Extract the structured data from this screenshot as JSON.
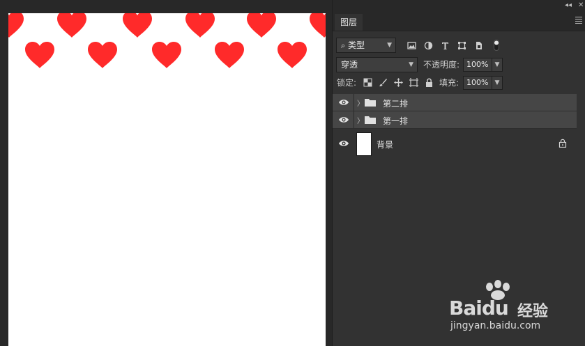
{
  "canvas": {
    "background": "#ffffff",
    "heart_color": "#ff2a2a"
  },
  "panel": {
    "collapse_icon": "double-chevron-left-icon",
    "close_icon": "close-icon",
    "tab_label": "图层",
    "menu_icon": "hamburger-menu-icon"
  },
  "filter": {
    "search_icon": "search-icon",
    "kind_label": "类型",
    "icons": [
      "image-filter-icon",
      "adjustment-filter-icon",
      "type-filter-icon",
      "shape-filter-icon",
      "smart-object-filter-icon",
      "filter-toggle-icon"
    ]
  },
  "blend": {
    "mode": "穿透",
    "opacity_label": "不透明度:",
    "opacity_value": "100%"
  },
  "lock": {
    "label": "锁定:",
    "icons": [
      "lock-transparent-pixels-icon",
      "lock-image-pixels-icon",
      "lock-position-icon",
      "lock-artboard-icon",
      "lock-all-icon"
    ],
    "fill_label": "填充:",
    "fill_value": "100%"
  },
  "layers": [
    {
      "name": "第二排",
      "type": "group"
    },
    {
      "name": "第一排",
      "type": "group"
    },
    {
      "name": "背景",
      "type": "background",
      "locked": true
    }
  ],
  "watermark": {
    "logo_bai": "Bai",
    "logo_du": "du",
    "logo_cn": "经验",
    "url": "jingyan.baidu.com"
  }
}
